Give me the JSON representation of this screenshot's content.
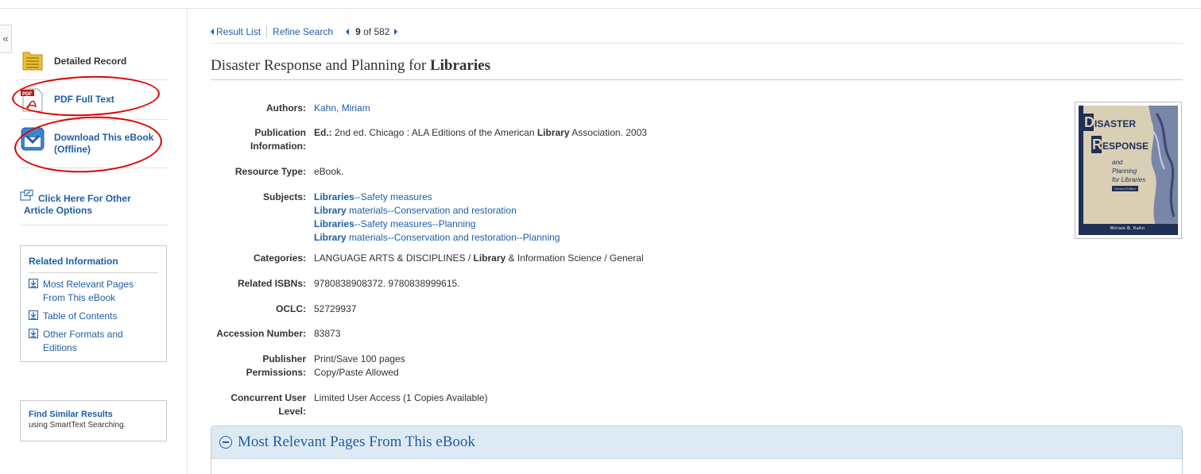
{
  "sidebar": {
    "collapse_glyph": "«",
    "detailed_record": "Detailed Record",
    "pdf_full_text": "PDF Full Text",
    "pdf_badge": "PDF",
    "download_line1": "Download This eBook",
    "download_line2": "(Offline)",
    "other_options_line1": "Click Here For Other",
    "other_options_line2": "Article Options",
    "related": {
      "heading": "Related Information",
      "items": [
        {
          "line1": "Most Relevant Pages",
          "line2": "From This eBook"
        },
        {
          "line1": "Table of Contents",
          "line2": ""
        },
        {
          "line1": "Other Formats and",
          "line2": "Editions"
        }
      ]
    },
    "similar": {
      "heading": "Find Similar Results",
      "sub": "using SmartText Searching."
    }
  },
  "nav": {
    "result_list": "Result List",
    "refine_search": "Refine Search",
    "position": "9",
    "of_total": "of 582"
  },
  "record": {
    "title_plain": "Disaster Response and Planning for ",
    "title_bold": "Libraries",
    "authors_label": "Authors:",
    "authors_value": "Kahn, Miriam",
    "pubinfo_label1": "Publication",
    "pubinfo_label2": "Information:",
    "pubinfo_ed": "Ed.:",
    "pubinfo_pre": " 2nd ed. Chicago : ALA Editions of the American ",
    "pubinfo_bold": "Library",
    "pubinfo_post": " Association. 2003",
    "resource_label": "Resource Type:",
    "resource_value": "eBook.",
    "subjects_label": "Subjects:",
    "subjects": [
      {
        "bold": "Libraries",
        "rest": "--Safety measures"
      },
      {
        "bold": "Library",
        "rest": " materials--Conservation and restoration"
      },
      {
        "bold": "Libraries",
        "rest": "--Safety measures--Planning"
      },
      {
        "bold": "Library",
        "rest": " materials--Conservation and restoration--Planning"
      }
    ],
    "categories_label": "Categories:",
    "categories_pre": "LANGUAGE ARTS & DISCIPLINES / ",
    "categories_bold": "Library",
    "categories_post": " & Information Science / General",
    "isbn_label": "Related ISBNs:",
    "isbn_value": "9780838908372. 9780838999615.",
    "oclc_label": "OCLC:",
    "oclc_value": "52729937",
    "accession_label": "Accession Number:",
    "accession_value": "83873",
    "publisher_label1": "Publisher",
    "publisher_label2": "Permissions:",
    "publisher_value1": "Print/Save 100 pages",
    "publisher_value2": "Copy/Paste Allowed",
    "concurrent_label": "Concurrent User Level:",
    "concurrent_value": "Limited User Access (1 Copies Available)"
  },
  "cover": {
    "big_d": "D",
    "isaster": "ISASTER",
    "big_r": "R",
    "esponse": "ESPONSE",
    "and": "and",
    "planning": "Planning",
    "for_libraries": "for Libraries",
    "edition": "Second Edition",
    "author": "Miriam B. Kahn"
  },
  "accordion": {
    "title": "Most Relevant Pages From This eBook"
  },
  "colors": {
    "link": "#1d5ea8",
    "annotation_red": "#e00000",
    "accordion_bg": "#deeaf3"
  }
}
